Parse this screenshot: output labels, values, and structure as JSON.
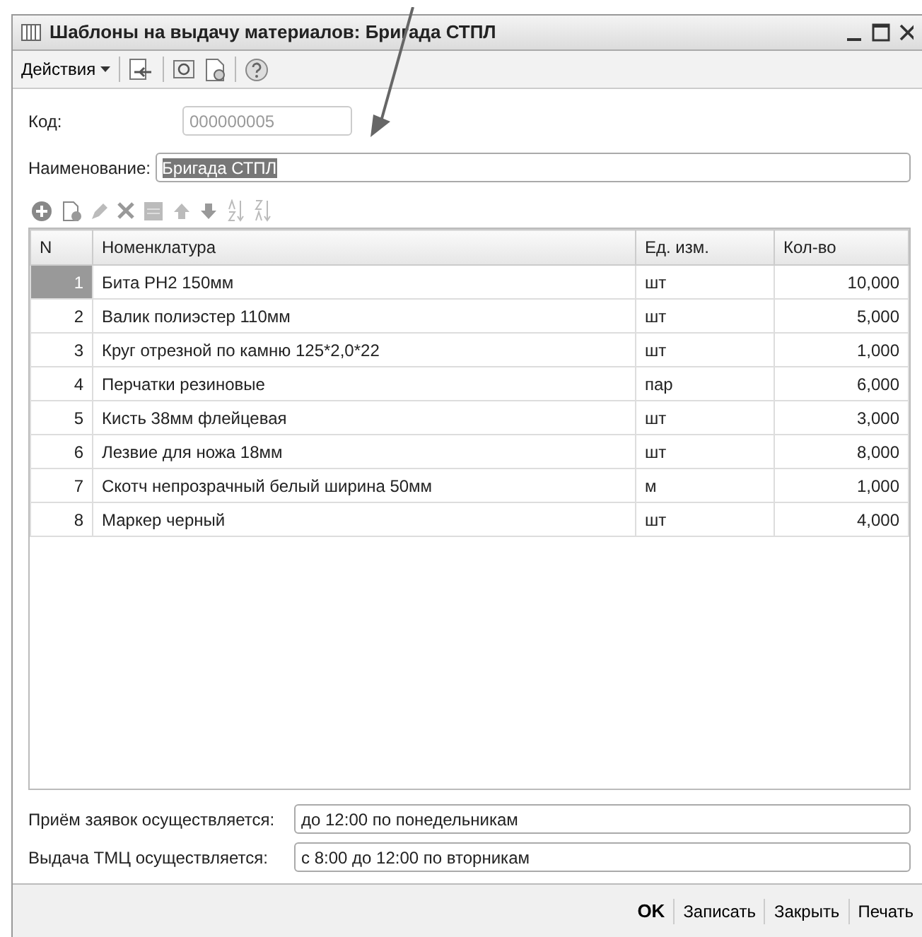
{
  "window": {
    "title": "Шаблоны на выдачу материалов: Бригада СТПЛ"
  },
  "toolbar": {
    "menu": "Действия"
  },
  "code_field": {
    "label": "Код:",
    "value": "000000005",
    "disabled": true
  },
  "name_field": {
    "label": "Наименование:",
    "value": "Бригада СТПЛ",
    "text_selected": true
  },
  "table": {
    "columns": [
      "N",
      "Номенклатура",
      "Ед. изм.",
      "Кол-во"
    ],
    "rows": [
      {
        "n": "1",
        "item": "Бита PH2 150мм",
        "unit": "шт",
        "qty": "10,000",
        "selected": true
      },
      {
        "n": "2",
        "item": "Валик полиэстер 110мм",
        "unit": "шт",
        "qty": "5,000",
        "selected": false
      },
      {
        "n": "3",
        "item": "Круг отрезной по камню 125*2,0*22",
        "unit": "шт",
        "qty": "1,000",
        "selected": false
      },
      {
        "n": "4",
        "item": "Перчатки резиновые",
        "unit": "пар",
        "qty": "6,000",
        "selected": false
      },
      {
        "n": "5",
        "item": "Кисть 38мм флейцевая",
        "unit": "шт",
        "qty": "3,000",
        "selected": false
      },
      {
        "n": "6",
        "item": "Лезвие для ножа 18мм",
        "unit": "шт",
        "qty": "8,000",
        "selected": false
      },
      {
        "n": "7",
        "item": "Скотч непрозрачный белый ширина 50мм",
        "unit": "м",
        "qty": "1,000",
        "selected": false
      },
      {
        "n": "8",
        "item": "Маркер черный",
        "unit": "шт",
        "qty": "4,000",
        "selected": false
      }
    ]
  },
  "bottom_fields": [
    {
      "label": "Приём заявок осуществляется:",
      "value": "до 12:00 по понедельникам"
    },
    {
      "label": "Выдача ТМЦ осуществляется:",
      "value": "с 8:00 до 12:00 по вторникам"
    }
  ],
  "buttons": [
    {
      "label": "OK",
      "default": true
    },
    {
      "label": "Записать",
      "default": false
    },
    {
      "label": "Закрыть",
      "default": false
    },
    {
      "label": "Печать",
      "default": false
    }
  ]
}
